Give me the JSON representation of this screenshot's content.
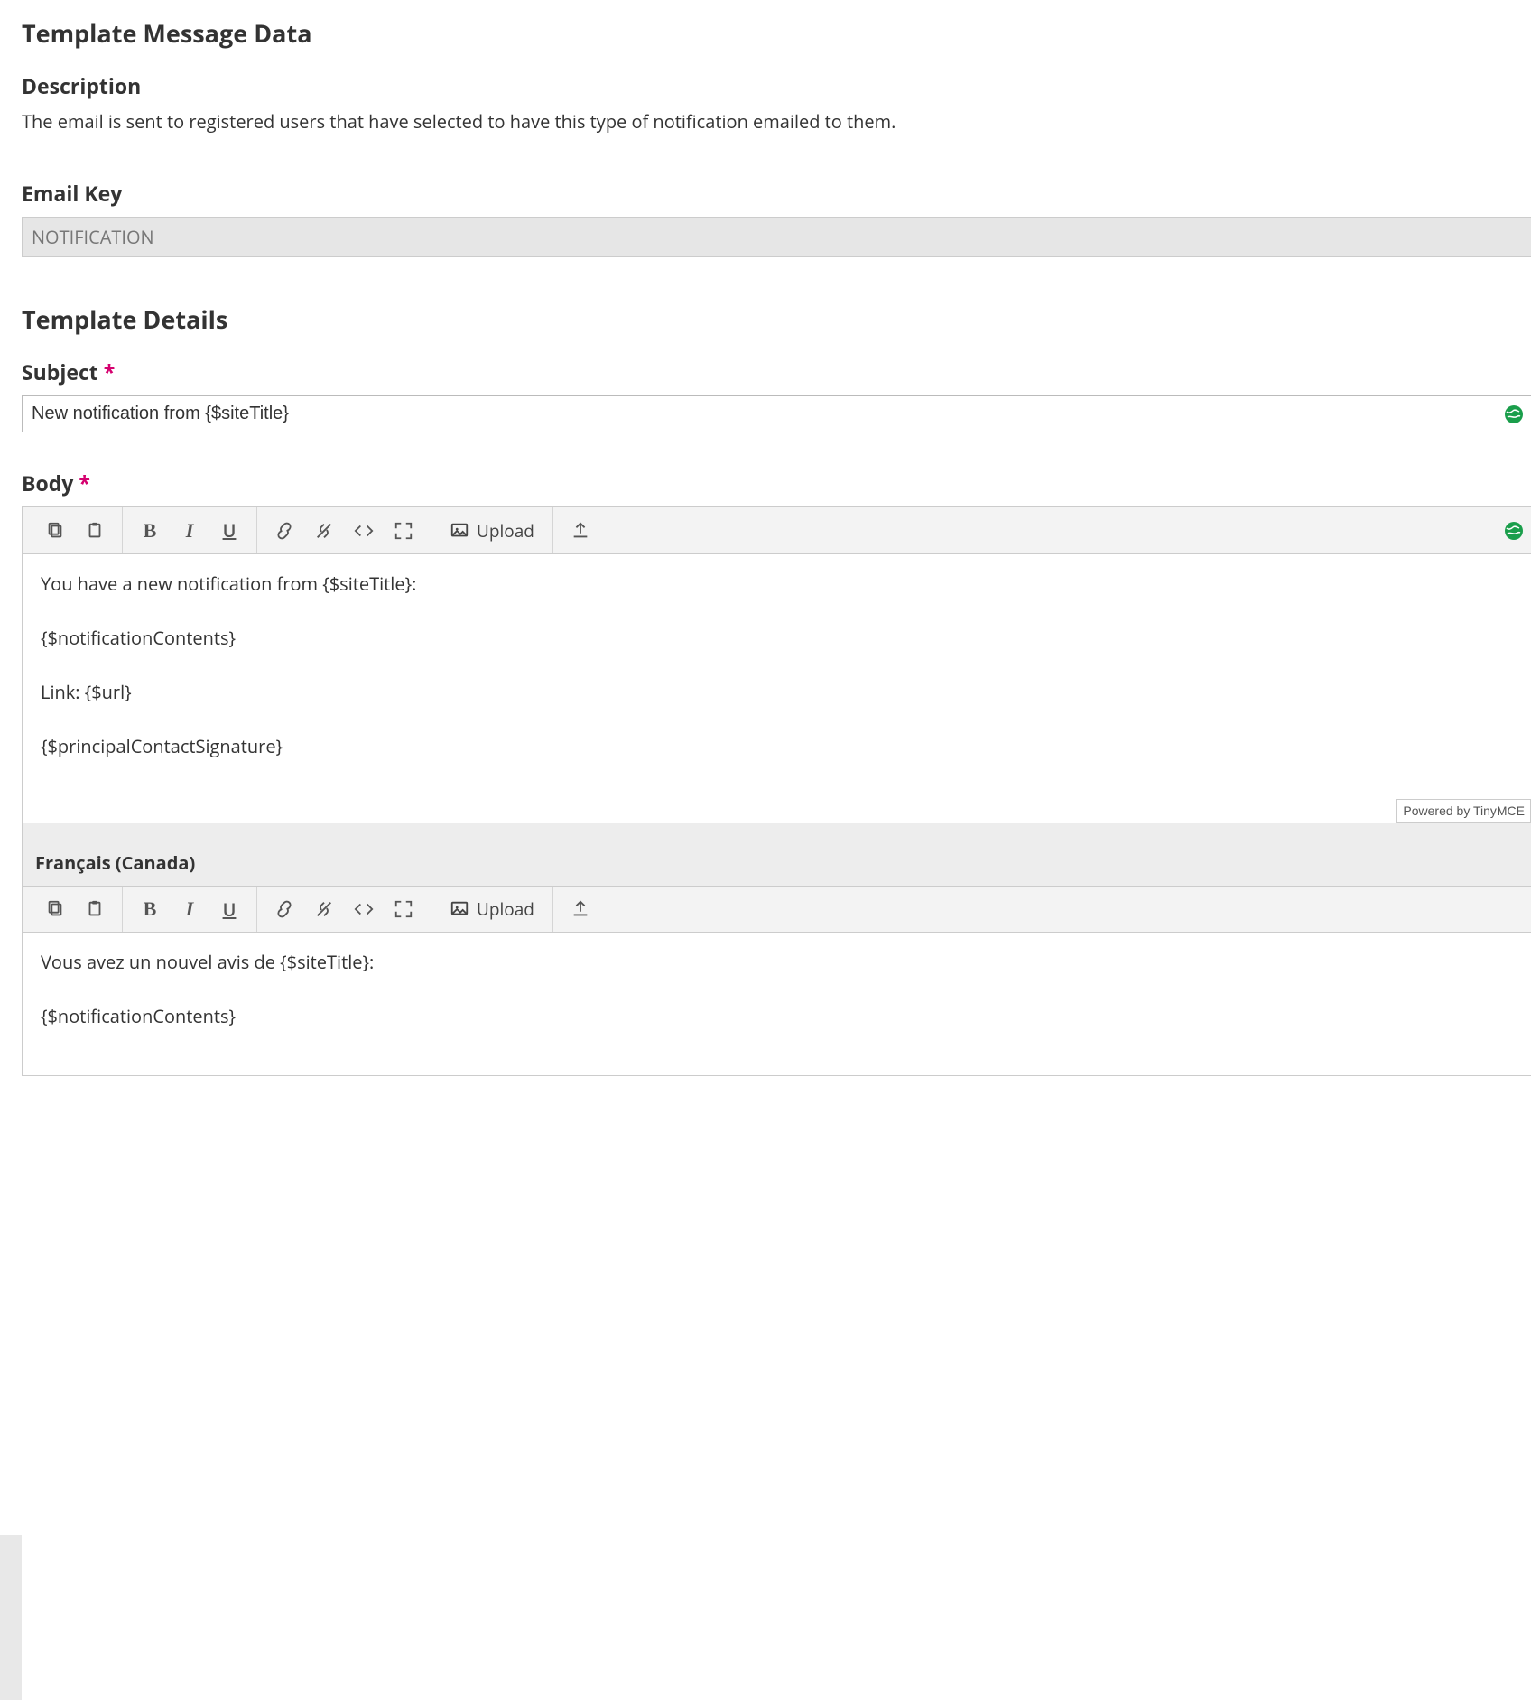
{
  "section_data": {
    "title": "Template Message Data"
  },
  "description": {
    "label": "Description",
    "text": "The email is sent to registered users that have selected to have this type of notification emailed to them."
  },
  "email_key": {
    "label": "Email Key",
    "value": "NOTIFICATION"
  },
  "section_details": {
    "title": "Template Details"
  },
  "subject": {
    "label": "Subject",
    "required_mark": "*",
    "value": "New notification from {$siteTitle}"
  },
  "body": {
    "label": "Body",
    "required_mark": "*",
    "toolbar": {
      "upload_label": "Upload"
    },
    "lines": {
      "l1": "You have a new notification from {$siteTitle}:",
      "l2": "{$notificationContents}",
      "l3": "Link: {$url}",
      "l4": "{$principalContactSignature}"
    },
    "powered_by": "Powered by TinyMCE"
  },
  "body_fr": {
    "lang_label": "Français (Canada)",
    "toolbar": {
      "upload_label": "Upload"
    },
    "lines": {
      "l1": "Vous avez un nouvel avis de {$siteTitle}:",
      "l2": "{$notificationContents}"
    }
  }
}
